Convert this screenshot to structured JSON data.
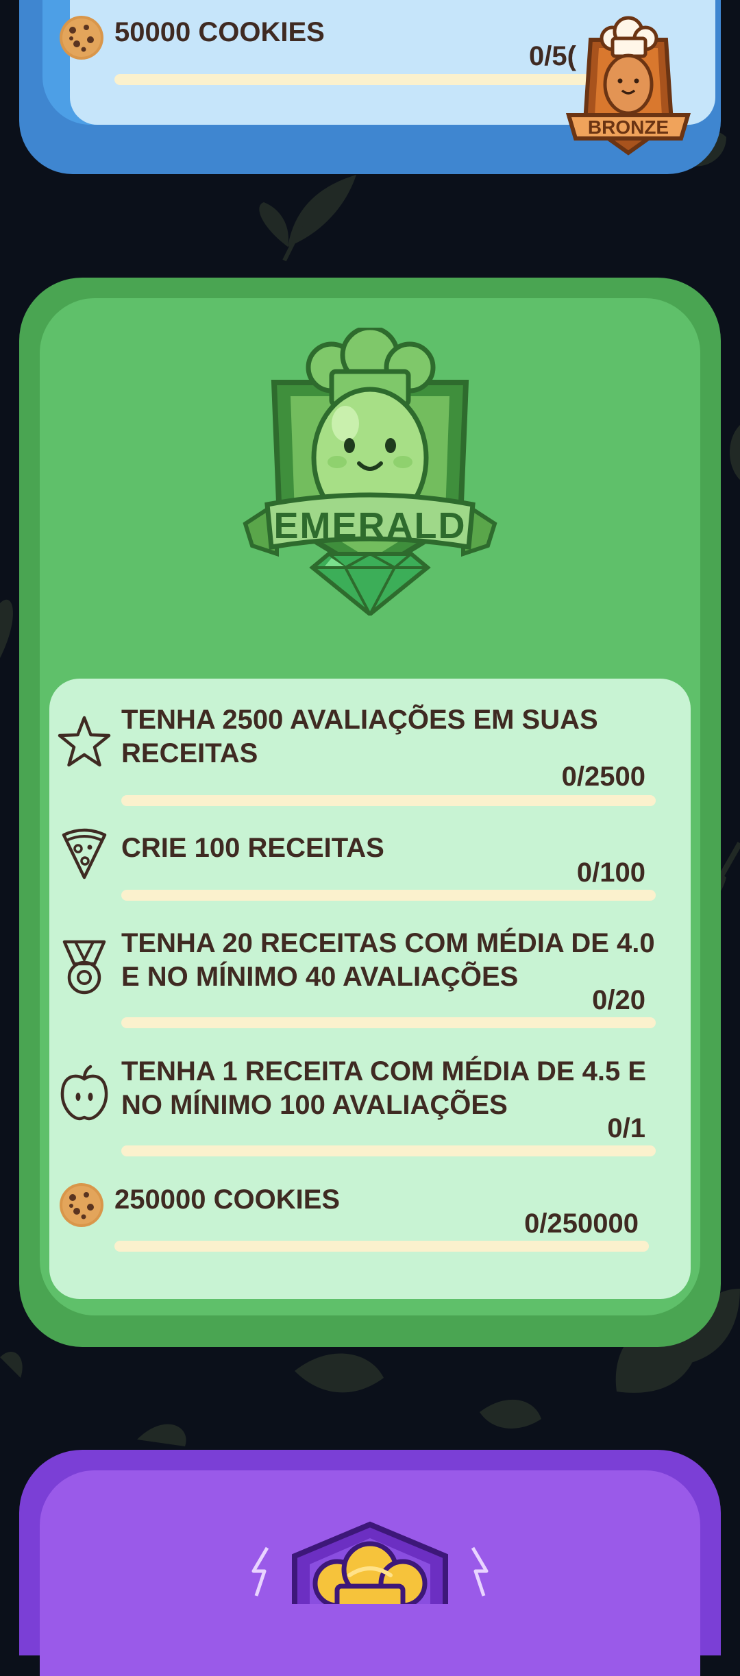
{
  "bronze_tier": {
    "badge_label": "BRONZE",
    "achievements": [
      {
        "icon": "cookie-icon",
        "title": "50000 COOKIES",
        "progress": "0/5(",
        "fraction": 0
      }
    ]
  },
  "emerald_tier": {
    "badge_label": "EMERALD",
    "achievements": [
      {
        "icon": "star-icon",
        "title_line1": "TENHA 2500 AVALIAÇÕES EM SUAS",
        "title_line2": "RECEITAS",
        "progress": "0/2500",
        "fraction": 0
      },
      {
        "icon": "pizza-slice-icon",
        "title_line1": "CRIE 100 RECEITAS",
        "progress": "0/100",
        "fraction": 0
      },
      {
        "icon": "medal-icon",
        "title_line1": "TENHA 20 RECEITAS COM MÉDIA DE 4.0",
        "title_line2": "E NO MÍNIMO 40 AVALIAÇÕES",
        "progress": "0/20",
        "fraction": 0
      },
      {
        "icon": "apple-icon",
        "title_line1": "TENHA 1 RECEITA COM MÉDIA DE 4.5 E",
        "title_line2": "NO MÍNIMO 100 AVALIAÇÕES",
        "progress": "0/1",
        "fraction": 0
      },
      {
        "icon": "cookie-icon",
        "title_line1": "250000 COOKIES",
        "progress": "0/250000",
        "fraction": 0
      }
    ]
  },
  "colors": {
    "background": "#0b101a",
    "bronze_card": "#3f86d0",
    "emerald_card": "#4aa552",
    "emerald_panel": "#c8f3d3",
    "next_tier_card": "#7b3fd6",
    "progress_track": "#fbf1cd",
    "text": "#3f2a22"
  }
}
